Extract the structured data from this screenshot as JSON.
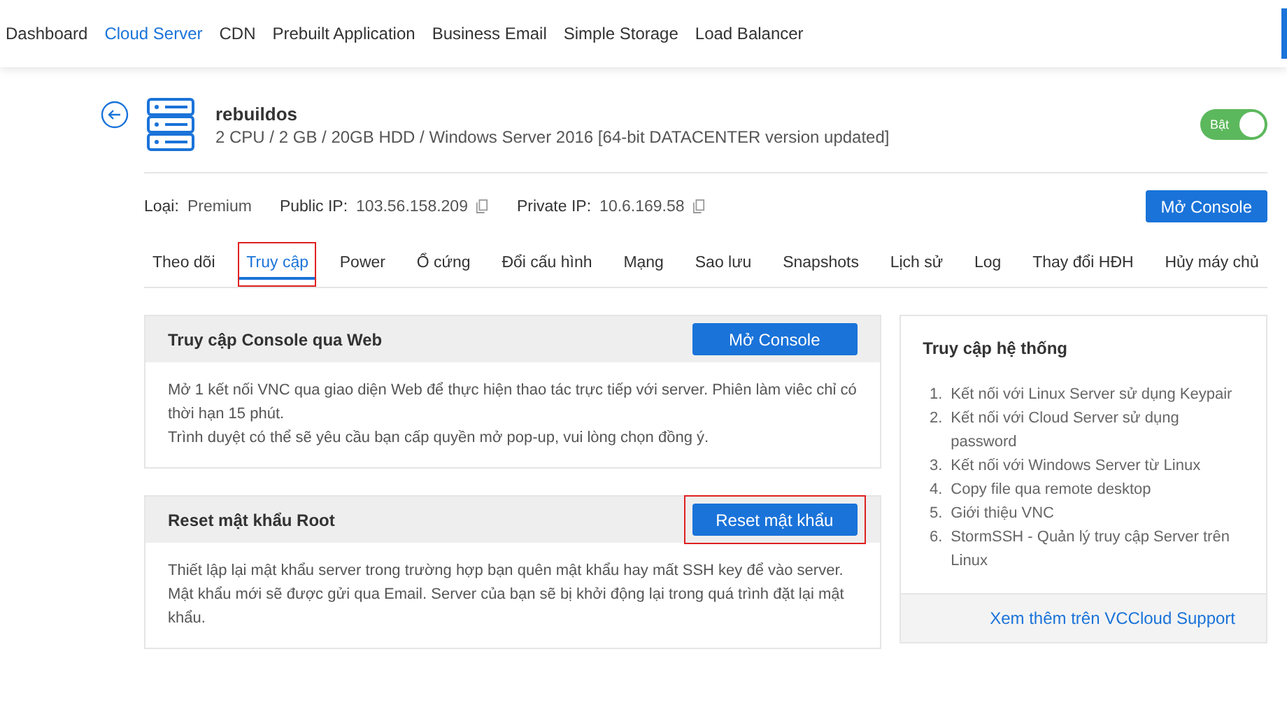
{
  "nav": [
    {
      "label": "Dashboard",
      "selected": false
    },
    {
      "label": "Cloud Server",
      "selected": true
    },
    {
      "label": "CDN",
      "selected": false
    },
    {
      "label": "Prebuilt Application",
      "selected": false
    },
    {
      "label": "Business Email",
      "selected": false
    },
    {
      "label": "Simple Storage",
      "selected": false
    },
    {
      "label": "Load Balancer",
      "selected": false
    }
  ],
  "server": {
    "name": "rebuildos",
    "specs": "2 CPU / 2 GB / 20GB HDD / Windows Server 2016 [64-bit DATACENTER version updated]",
    "power": {
      "label": "Bật",
      "on": true
    }
  },
  "info": [
    {
      "label": "Loại:",
      "value": "Premium",
      "copyable": false
    },
    {
      "label": "Public IP:",
      "value": "103.56.158.209",
      "copyable": true
    },
    {
      "label": "Private IP:",
      "value": "10.6.169.58",
      "copyable": true
    }
  ],
  "console_button": "Mở Console",
  "tabs": [
    {
      "label": "Theo dõi",
      "selected": false,
      "highlighted": false
    },
    {
      "label": "Truy cập",
      "selected": true,
      "highlighted": true
    },
    {
      "label": "Power",
      "selected": false,
      "highlighted": false
    },
    {
      "label": "Ổ cứng",
      "selected": false,
      "highlighted": false
    },
    {
      "label": "Đổi cấu hình",
      "selected": false,
      "highlighted": false
    },
    {
      "label": "Mạng",
      "selected": false,
      "highlighted": false
    },
    {
      "label": "Sao lưu",
      "selected": false,
      "highlighted": false
    },
    {
      "label": "Snapshots",
      "selected": false,
      "highlighted": false
    },
    {
      "label": "Lịch sử",
      "selected": false,
      "highlighted": false
    },
    {
      "label": "Log",
      "selected": false,
      "highlighted": false
    },
    {
      "label": "Thay đổi HĐH",
      "selected": false,
      "highlighted": false
    },
    {
      "label": "Hủy máy chủ",
      "selected": false,
      "highlighted": false
    }
  ],
  "panels": [
    {
      "title": "Truy cập Console qua Web",
      "button": "Mở Console",
      "highlighted": false,
      "paragraphs": [
        "Mở 1 kết nối VNC qua giao diện Web để thực hiện thao tác trực tiếp với server. Phiên làm viêc chỉ có thời hạn 15 phút.",
        "Trình duyệt có thể sẽ yêu cầu bạn cấp quyền mở pop-up, vui lòng chọn đồng ý."
      ]
    },
    {
      "title": "Reset mật khẩu Root",
      "button": "Reset mật khẩu",
      "highlighted": true,
      "paragraphs": [
        "Thiết lập lại mật khẩu server trong trường hợp bạn quên mật khẩu hay mất SSH key để vào server. Mật khẩu mới sẽ được gửi qua Email. Server của bạn sẽ bị khởi động lại trong quá trình đặt lại mật khẩu."
      ]
    }
  ],
  "sidebar": {
    "title": "Truy cập hệ thống",
    "items": [
      {
        "number": "1.",
        "text": "Kết nối với Linux Server sử dụng Keypair"
      },
      {
        "number": "2.",
        "text": "Kết nối với Cloud Server sử dụng password"
      },
      {
        "number": "3.",
        "text": "Kết nối với Windows Server từ Linux"
      },
      {
        "number": "4.",
        "text": "Copy file qua remote desktop"
      },
      {
        "number": "5.",
        "text": "Giới thiệu VNC"
      },
      {
        "number": "6.",
        "text": "StormSSH - Quản lý truy cập Server trên Linux"
      }
    ],
    "link": "Xem thêm trên VCCloud Support"
  }
}
